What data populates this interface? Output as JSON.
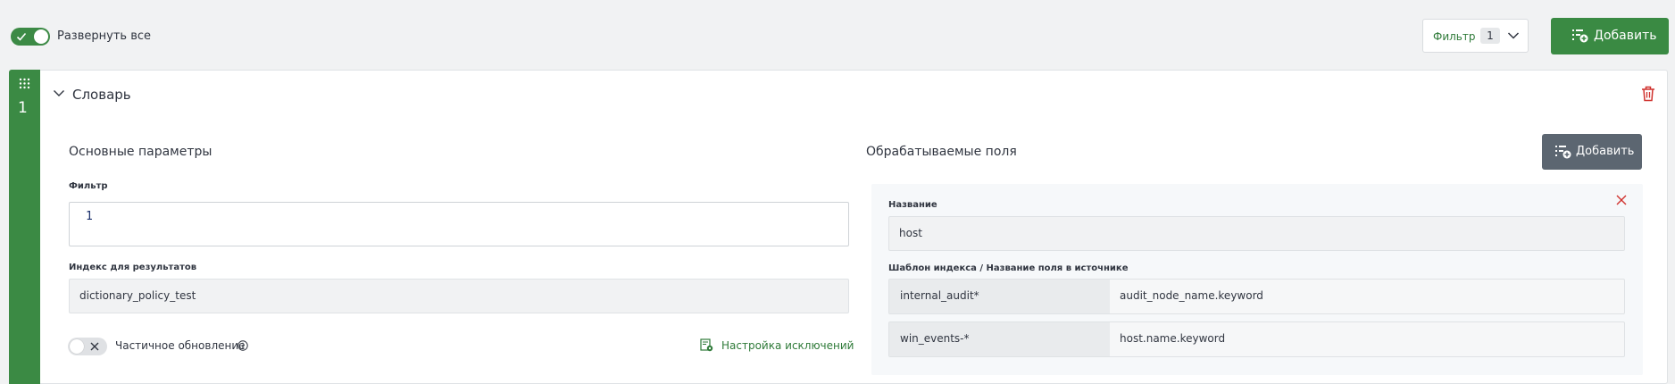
{
  "toolbar": {
    "expand_all_label": "Развернуть все",
    "expand_all_on": true,
    "filter_label": "Фильтр",
    "filter_count": "1",
    "add_label": "Добавить"
  },
  "card": {
    "index": "1",
    "title": "Словарь",
    "left": {
      "section_title": "Основные параметры",
      "filter_label": "Фильтр",
      "filter_editor_line_number": "1",
      "index_label": "Индекс для результатов",
      "index_value": "dictionary_policy_test",
      "partial_update_label": "Частичное обновление",
      "partial_update_on": false,
      "exclusions_link": "Настройка исключений"
    },
    "right": {
      "section_title": "Обрабатываемые поля",
      "add_label": "Добавить",
      "field": {
        "name_label": "Название",
        "name_value": "host",
        "template_label": "Шаблон индекса / Название поля в источнике",
        "mappings": [
          {
            "index_pattern": "internal_audit*",
            "source_field": "audit_node_name.keyword"
          },
          {
            "index_pattern": "win_events-*",
            "source_field": "host.name.keyword"
          }
        ]
      }
    }
  },
  "colors": {
    "primary_green": "#3a8a43",
    "dark_button": "#5c6671",
    "delete_red": "#d0312d"
  }
}
